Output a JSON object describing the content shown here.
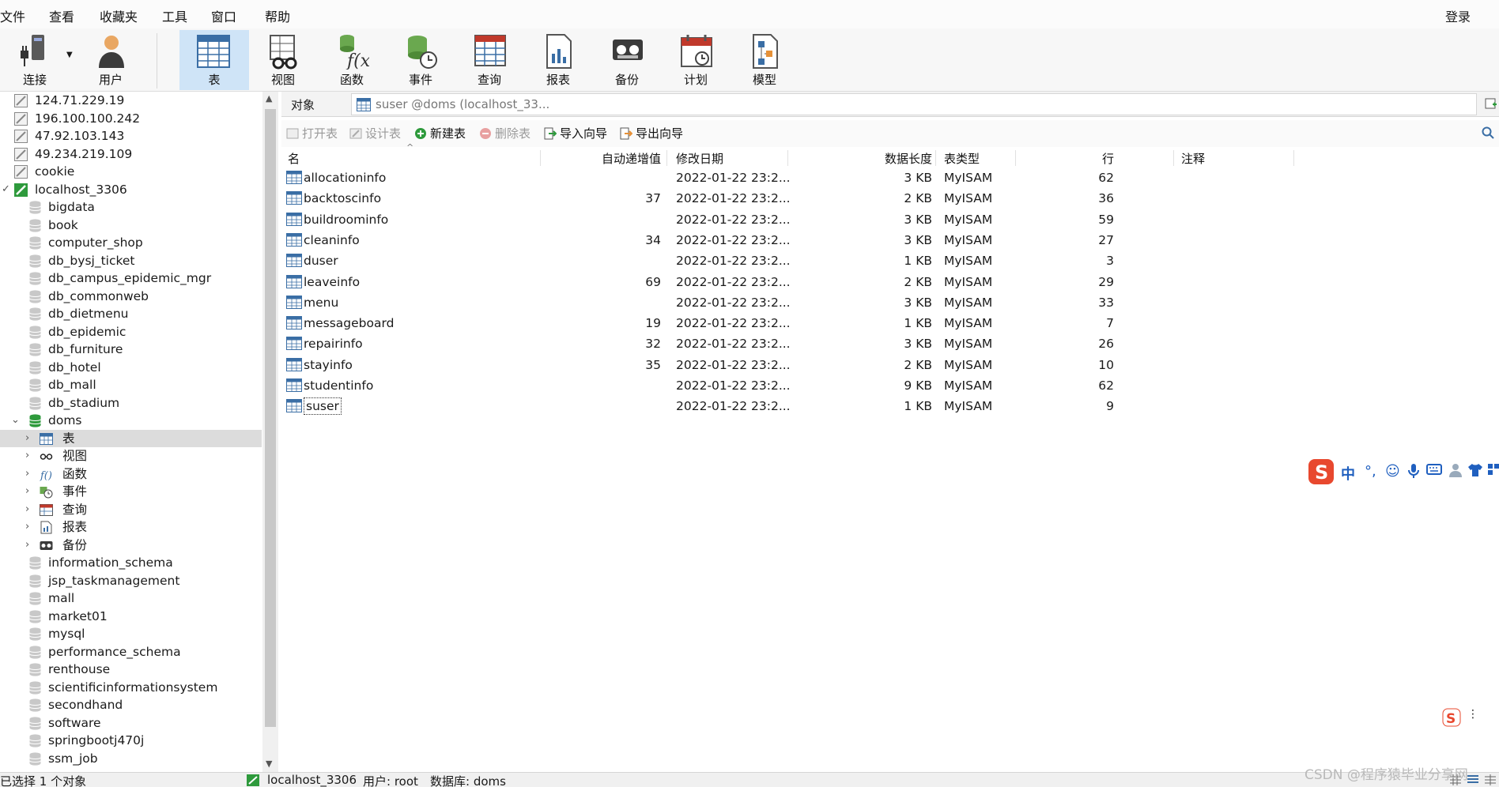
{
  "menu": [
    "文件",
    "查看",
    "收藏夹",
    "工具",
    "窗口",
    "帮助"
  ],
  "login_label": "登录",
  "toolbar": [
    {
      "label": "连接",
      "icon": "connect-icon"
    },
    {
      "label": "用户",
      "icon": "user-icon"
    },
    {
      "label": "表",
      "icon": "table-icon"
    },
    {
      "label": "视图",
      "icon": "view-icon"
    },
    {
      "label": "函数",
      "icon": "function-icon"
    },
    {
      "label": "事件",
      "icon": "event-icon"
    },
    {
      "label": "查询",
      "icon": "query-icon"
    },
    {
      "label": "报表",
      "icon": "report-icon"
    },
    {
      "label": "备份",
      "icon": "backup-icon"
    },
    {
      "label": "计划",
      "icon": "schedule-icon"
    },
    {
      "label": "模型",
      "icon": "model-icon"
    }
  ],
  "tree": {
    "connections_top": [
      "124.71.229.19",
      "196.100.100.242",
      "47.92.103.143",
      "49.234.219.109",
      "cookie"
    ],
    "open_connection": "localhost_3306",
    "databases_before": [
      "bigdata",
      "book",
      "computer_shop",
      "db_bysj_ticket",
      "db_campus_epidemic_mgr",
      "db_commonweb",
      "db_dietmenu",
      "db_epidemic",
      "db_furniture",
      "db_hotel",
      "db_mall",
      "db_stadium"
    ],
    "open_db": "doms",
    "db_children": [
      "表",
      "视图",
      "函数",
      "事件",
      "查询",
      "报表",
      "备份"
    ],
    "databases_after": [
      "information_schema",
      "jsp_taskmanagement",
      "mall",
      "market01",
      "mysql",
      "performance_schema",
      "renthouse",
      "scientificinformationsystem",
      "secondhand",
      "software",
      "springbootj470j",
      "ssm_job"
    ]
  },
  "tabs": {
    "objects_label": "对象",
    "doc_tab_label": "suser @doms (localhost_33..."
  },
  "object_toolbar": {
    "open": "打开表",
    "design": "设计表",
    "new": "新建表",
    "delete": "删除表",
    "import": "导入向导",
    "export": "导出向导"
  },
  "columns": [
    "名",
    "自动递增值",
    "修改日期",
    "数据长度",
    "表类型",
    "行",
    "注释"
  ],
  "rows": [
    {
      "name": "allocationinfo",
      "auto": "",
      "date": "2022-01-22 23:2...",
      "size": "3 KB",
      "type": "MyISAM",
      "rows": "62",
      "comment": ""
    },
    {
      "name": "backtoscinfo",
      "auto": "37",
      "date": "2022-01-22 23:2...",
      "size": "2 KB",
      "type": "MyISAM",
      "rows": "36",
      "comment": ""
    },
    {
      "name": "buildroominfo",
      "auto": "",
      "date": "2022-01-22 23:2...",
      "size": "3 KB",
      "type": "MyISAM",
      "rows": "59",
      "comment": ""
    },
    {
      "name": "cleaninfo",
      "auto": "34",
      "date": "2022-01-22 23:2...",
      "size": "3 KB",
      "type": "MyISAM",
      "rows": "27",
      "comment": ""
    },
    {
      "name": "duser",
      "auto": "",
      "date": "2022-01-22 23:2...",
      "size": "1 KB",
      "type": "MyISAM",
      "rows": "3",
      "comment": ""
    },
    {
      "name": "leaveinfo",
      "auto": "69",
      "date": "2022-01-22 23:2...",
      "size": "2 KB",
      "type": "MyISAM",
      "rows": "29",
      "comment": ""
    },
    {
      "name": "menu",
      "auto": "",
      "date": "2022-01-22 23:2...",
      "size": "3 KB",
      "type": "MyISAM",
      "rows": "33",
      "comment": ""
    },
    {
      "name": "messageboard",
      "auto": "19",
      "date": "2022-01-22 23:2...",
      "size": "1 KB",
      "type": "MyISAM",
      "rows": "7",
      "comment": ""
    },
    {
      "name": "repairinfo",
      "auto": "32",
      "date": "2022-01-22 23:2...",
      "size": "3 KB",
      "type": "MyISAM",
      "rows": "26",
      "comment": ""
    },
    {
      "name": "stayinfo",
      "auto": "35",
      "date": "2022-01-22 23:2...",
      "size": "2 KB",
      "type": "MyISAM",
      "rows": "10",
      "comment": ""
    },
    {
      "name": "studentinfo",
      "auto": "",
      "date": "2022-01-22 23:2...",
      "size": "9 KB",
      "type": "MyISAM",
      "rows": "62",
      "comment": ""
    },
    {
      "name": "suser",
      "auto": "",
      "date": "2022-01-22 23:2...",
      "size": "1 KB",
      "type": "MyISAM",
      "rows": "9",
      "comment": ""
    }
  ],
  "ime": {
    "glyphs": [
      "中",
      "°,",
      "☺",
      "🎤",
      "⌨",
      "👕"
    ]
  },
  "status": {
    "selected": "已选择 1 个对象",
    "connection": "localhost_3306",
    "user": "用户: root",
    "database": "数据库: doms"
  },
  "watermark": "CSDN @程序猿毕业分享网",
  "colors": {
    "accent": "#cfe4f7",
    "selection": "#dcdcdc",
    "conn_green": "#2e9a3c",
    "ime_red": "#e8482e"
  }
}
